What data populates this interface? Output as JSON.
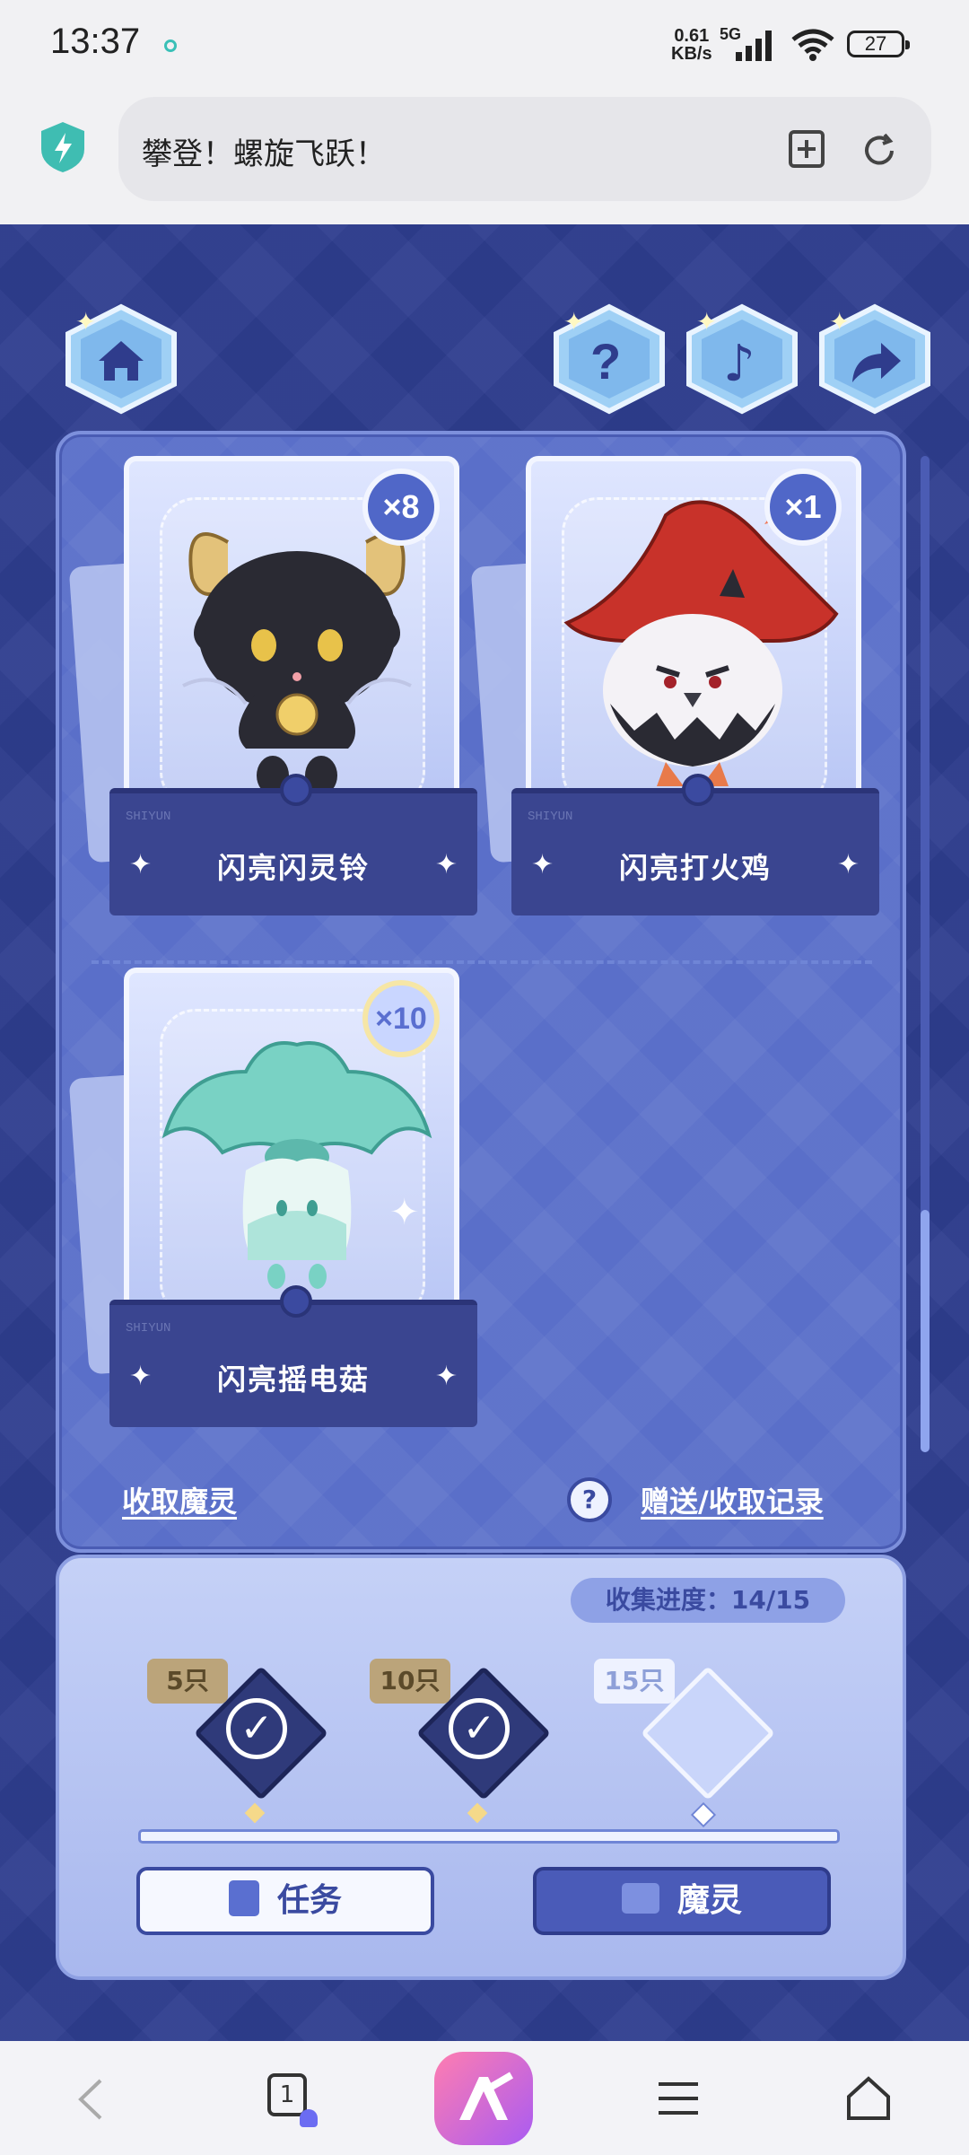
{
  "status_bar": {
    "time": "13:37",
    "net_speed_value": "0.61",
    "net_speed_unit": "KB/s",
    "network": "5G",
    "battery": "27"
  },
  "browser": {
    "page_title": "攀登！螺旋飞跃！",
    "tab_count": "1"
  },
  "top_buttons": [
    "home-icon",
    "question-icon",
    "music-note-icon",
    "share-icon"
  ],
  "cards": [
    {
      "name": "闪亮闪灵铃",
      "count": "×8"
    },
    {
      "name": "闪亮打火鸡",
      "count": "×1"
    },
    {
      "name": "闪亮摇电菇",
      "count": "×10"
    }
  ],
  "card_tag": "SHIYUN",
  "links": {
    "collect": "收取魔灵",
    "records": "赠送/收取记录",
    "help_glyph": "?"
  },
  "collection": {
    "progress_label": "收集进度：",
    "progress_value": "14/15",
    "progress_fraction": 0.93,
    "rewards": [
      {
        "label": "5只",
        "claimed": true
      },
      {
        "label": "10只",
        "claimed": true
      },
      {
        "label": "15只",
        "claimed": false
      }
    ]
  },
  "buttons": {
    "task": "任务",
    "spirit": "魔灵"
  },
  "colors": {
    "background": "#2e3d8e",
    "panel": "#5a6fc9",
    "card_base": "#3a4590",
    "accent_gold": "#f5d98a"
  }
}
